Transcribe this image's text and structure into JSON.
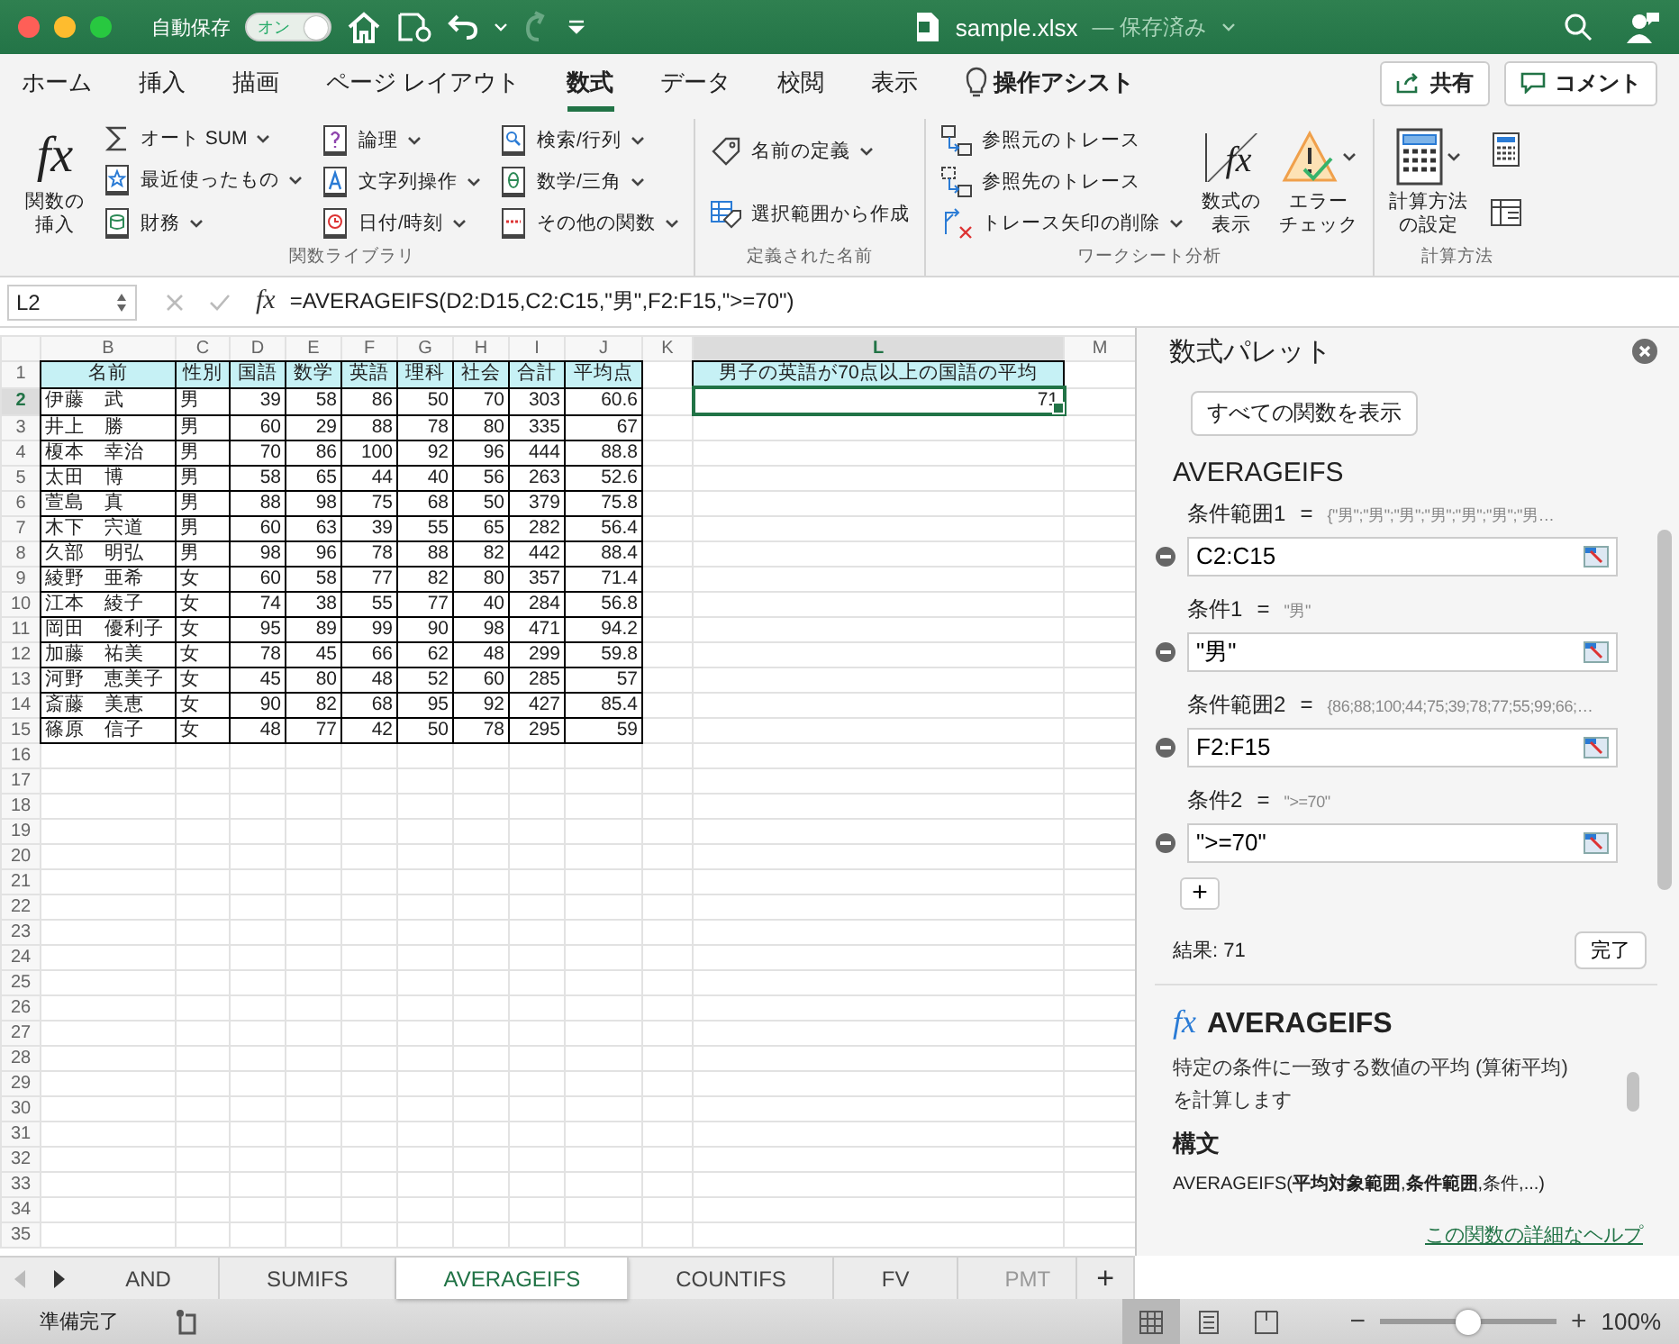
{
  "title_bar": {
    "autosave_label": "自動保存",
    "autosave_toggle": {
      "label": "オン",
      "on": true
    },
    "redo": {
      "disabled": true
    },
    "file_name": "sample.xlsx",
    "save_status": "— 保存済み"
  },
  "ribbon_tabs": [
    {
      "label": "ホーム",
      "selected": false
    },
    {
      "label": "挿入",
      "selected": false
    },
    {
      "label": "描画",
      "selected": false
    },
    {
      "label": "ページ レイアウト",
      "selected": false
    },
    {
      "label": "数式",
      "selected": true
    },
    {
      "label": "データ",
      "selected": false
    },
    {
      "label": "校閲",
      "selected": false
    },
    {
      "label": "表示",
      "selected": false
    }
  ],
  "assist": "操作アシスト",
  "share_button": "共有",
  "comment_button": "コメント",
  "ribbon_groups": [
    {
      "label": "関数ライブラリ",
      "columns": [
        [
          {
            "kind": "large",
            "glyph": "fx",
            "label_lines": [
              "関数の",
              "挿入"
            ],
            "dropdown": false
          }
        ],
        [
          {
            "kind": "small",
            "label": "オート SUM",
            "dropdown": true
          },
          {
            "kind": "small",
            "label": "最近使ったもの",
            "dropdown": true
          },
          {
            "kind": "small",
            "label": "財務",
            "dropdown": true
          }
        ],
        [
          {
            "kind": "small",
            "label": "論理",
            "dropdown": true
          },
          {
            "kind": "small",
            "label": "文字列操作",
            "dropdown": true
          },
          {
            "kind": "small",
            "label": "日付/時刻",
            "dropdown": true
          }
        ],
        [
          {
            "kind": "small",
            "label": "検索/行列",
            "dropdown": true
          },
          {
            "kind": "small",
            "label": "数学/三角",
            "dropdown": true
          },
          {
            "kind": "small",
            "label": "その他の関数",
            "dropdown": true
          }
        ]
      ]
    },
    {
      "label": "定義された名前",
      "columns": [
        [
          {
            "kind": "small",
            "label": "名前の定義",
            "dropdown": true
          },
          {
            "kind": "small",
            "label": "選択範囲から作成",
            "dropdown": false
          }
        ]
      ]
    },
    {
      "label": "ワークシート分析",
      "columns": [
        [
          {
            "kind": "small",
            "label": "参照元のトレース",
            "dropdown": false
          },
          {
            "kind": "small",
            "label": "参照先のトレース",
            "dropdown": false
          },
          {
            "kind": "small",
            "label": "トレース矢印の削除",
            "dropdown": true
          }
        ],
        [
          {
            "kind": "large",
            "glyph": "fx",
            "label_lines": [
              "数式の",
              "表示"
            ],
            "dropdown": false
          }
        ],
        [
          {
            "kind": "large",
            "label_lines": [
              "エラー",
              "チェック"
            ],
            "dropdown": true
          }
        ]
      ]
    },
    {
      "label": "計算方法",
      "columns": [
        [
          {
            "kind": "large",
            "label_lines": [
              "計算方法",
              "の設定"
            ],
            "dropdown": true
          }
        ],
        [
          {
            "kind": "icon",
            "dropdown": false
          },
          {
            "kind": "icon",
            "dropdown": false
          }
        ]
      ]
    }
  ],
  "formula_bar": {
    "name_box": "L2",
    "fx_label": "fx",
    "formula": "=AVERAGEIFS(D2:D15,C2:C15,\"男\",F2:F15,\">=70\")"
  },
  "sheet": {
    "columns": [
      {
        "label": "B",
        "selected": false
      },
      {
        "label": "C",
        "selected": false
      },
      {
        "label": "D",
        "selected": false
      },
      {
        "label": "E",
        "selected": false
      },
      {
        "label": "F",
        "selected": false
      },
      {
        "label": "G",
        "selected": false
      },
      {
        "label": "H",
        "selected": false
      },
      {
        "label": "I",
        "selected": false
      },
      {
        "label": "J",
        "selected": false
      },
      {
        "label": "K",
        "selected": false
      },
      {
        "label": "L",
        "selected": true
      },
      {
        "label": "M",
        "selected": false
      }
    ],
    "rows": [
      {
        "number": "1",
        "selected": false,
        "kind": "header",
        "cells": [
          "名前",
          "性別",
          "国語",
          "数学",
          "英語",
          "理科",
          "社会",
          "合計",
          "平均点"
        ],
        "extra": {
          "kind": "header",
          "text": "男子の英語が70点以上の国語の平均"
        }
      },
      {
        "number": "2",
        "selected": true,
        "kind": "data",
        "cells": [
          "伊藤　武",
          "男",
          "39",
          "58",
          "86",
          "50",
          "70",
          "303",
          "60.6"
        ],
        "extra": {
          "kind": "value",
          "text": "71"
        }
      },
      {
        "number": "3",
        "selected": false,
        "kind": "data",
        "cells": [
          "井上　勝",
          "男",
          "60",
          "29",
          "88",
          "78",
          "80",
          "335",
          "67"
        ]
      },
      {
        "number": "4",
        "selected": false,
        "kind": "data",
        "cells": [
          "榎本　幸治",
          "男",
          "70",
          "86",
          "100",
          "92",
          "96",
          "444",
          "88.8"
        ]
      },
      {
        "number": "5",
        "selected": false,
        "kind": "data",
        "cells": [
          "太田　博",
          "男",
          "58",
          "65",
          "44",
          "40",
          "56",
          "263",
          "52.6"
        ]
      },
      {
        "number": "6",
        "selected": false,
        "kind": "data",
        "cells": [
          "萱島　真",
          "男",
          "88",
          "98",
          "75",
          "68",
          "50",
          "379",
          "75.8"
        ]
      },
      {
        "number": "7",
        "selected": false,
        "kind": "data",
        "cells": [
          "木下　宍道",
          "男",
          "60",
          "63",
          "39",
          "55",
          "65",
          "282",
          "56.4"
        ]
      },
      {
        "number": "8",
        "selected": false,
        "kind": "data",
        "cells": [
          "久部　明弘",
          "男",
          "98",
          "96",
          "78",
          "88",
          "82",
          "442",
          "88.4"
        ]
      },
      {
        "number": "9",
        "selected": false,
        "kind": "data",
        "cells": [
          "綾野　亜希",
          "女",
          "60",
          "58",
          "77",
          "82",
          "80",
          "357",
          "71.4"
        ]
      },
      {
        "number": "10",
        "selected": false,
        "kind": "data",
        "cells": [
          "江本　綾子",
          "女",
          "74",
          "38",
          "55",
          "77",
          "40",
          "284",
          "56.8"
        ]
      },
      {
        "number": "11",
        "selected": false,
        "kind": "data",
        "cells": [
          "岡田　優利子",
          "女",
          "95",
          "89",
          "99",
          "90",
          "98",
          "471",
          "94.2"
        ]
      },
      {
        "number": "12",
        "selected": false,
        "kind": "data",
        "cells": [
          "加藤　祐美",
          "女",
          "78",
          "45",
          "66",
          "62",
          "48",
          "299",
          "59.8"
        ]
      },
      {
        "number": "13",
        "selected": false,
        "kind": "data",
        "cells": [
          "河野　恵美子",
          "女",
          "45",
          "80",
          "48",
          "52",
          "60",
          "285",
          "57"
        ]
      },
      {
        "number": "14",
        "selected": false,
        "kind": "data",
        "cells": [
          "斎藤　美恵",
          "女",
          "90",
          "82",
          "68",
          "95",
          "92",
          "427",
          "85.4"
        ]
      },
      {
        "number": "15",
        "selected": false,
        "kind": "data",
        "cells": [
          "篠原　信子",
          "女",
          "48",
          "77",
          "42",
          "50",
          "78",
          "295",
          "59"
        ]
      },
      {
        "number": "16",
        "selected": false
      },
      {
        "number": "17",
        "selected": false
      },
      {
        "number": "18",
        "selected": false
      },
      {
        "number": "19",
        "selected": false
      },
      {
        "number": "20",
        "selected": false
      },
      {
        "number": "21",
        "selected": false
      },
      {
        "number": "22",
        "selected": false
      },
      {
        "number": "23",
        "selected": false
      },
      {
        "number": "24",
        "selected": false
      },
      {
        "number": "25",
        "selected": false
      },
      {
        "number": "26",
        "selected": false
      },
      {
        "number": "27",
        "selected": false
      },
      {
        "number": "28",
        "selected": false
      },
      {
        "number": "29",
        "selected": false
      },
      {
        "number": "30",
        "selected": false
      },
      {
        "number": "31",
        "selected": false
      },
      {
        "number": "32",
        "selected": false
      },
      {
        "number": "33",
        "selected": false
      },
      {
        "number": "34",
        "selected": false
      },
      {
        "number": "35",
        "selected": false
      }
    ]
  },
  "formula_palette": {
    "title": "数式パレット",
    "back_button": "すべての関数を表示",
    "function_name": "AVERAGEIFS",
    "arguments": [
      {
        "label": "条件範囲1",
        "equals": "=",
        "preview": "{\"男\";\"男\";\"男\";\"男\";\"男\";\"男\";\"男…",
        "value": "C2:C15"
      },
      {
        "label": "条件1",
        "equals": "=",
        "preview": "\"男\"",
        "value": "\"男\""
      },
      {
        "label": "条件範囲2",
        "equals": "=",
        "preview": "{86;88;100;44;75;39;78;77;55;99;66;…",
        "value": "F2:F15"
      },
      {
        "label": "条件2",
        "equals": "=",
        "preview": "\">=70\"",
        "value": "\">=70\""
      }
    ],
    "add_button": "+",
    "result_label": "結果: 71",
    "done_button": "完了",
    "help": {
      "glyph": "fx",
      "name": "AVERAGEIFS",
      "description": "特定の条件に一致する数値の平均 (算術平均) を計算します",
      "syntax_heading": "構文",
      "syntax": "AVERAGEIFS(**平均対象範囲**,**条件範囲**,条件,...)",
      "link": "この関数の詳細なヘルプ"
    }
  },
  "sheet_tabs": {
    "nav": [
      {
        "disabled": true
      },
      {
        "disabled": false
      }
    ],
    "tabs": [
      {
        "label": "AND",
        "selected": false
      },
      {
        "label": "SUMIFS",
        "selected": false
      },
      {
        "label": "AVERAGEIFS",
        "selected": true
      },
      {
        "label": "COUNTIFS",
        "selected": false
      },
      {
        "label": "FV",
        "selected": false
      },
      {
        "label": "PMT",
        "selected": false
      }
    ],
    "add_button": "+"
  },
  "status_bar": {
    "status": "準備完了",
    "view_buttons": [
      {
        "selected": true
      },
      {
        "selected": false
      },
      {
        "selected": false
      }
    ],
    "zoom_minus": "−",
    "zoom_plus": "+",
    "zoom": {
      "level": 0.5
    },
    "zoom_percent": "100%"
  }
}
